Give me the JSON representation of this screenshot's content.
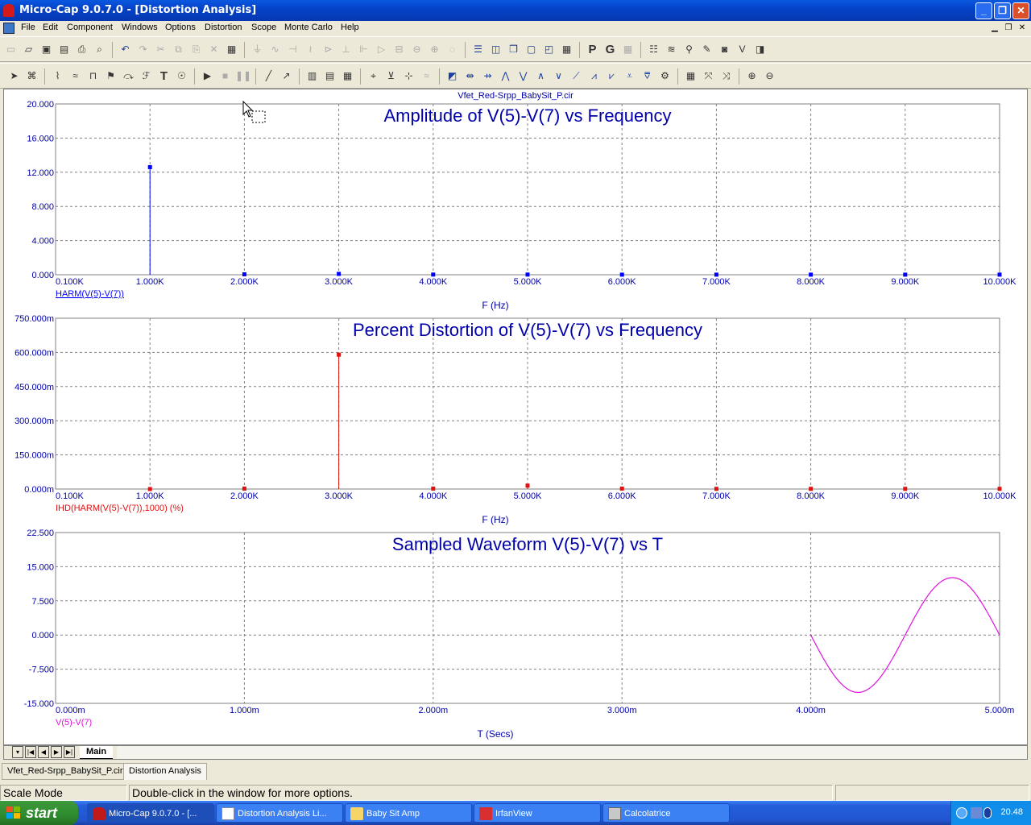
{
  "window": {
    "title": "Micro-Cap 9.0.7.0 - [Distortion Analysis]",
    "min_icon": "minimize-icon",
    "max_icon": "restore-icon",
    "close_icon": "close-icon"
  },
  "menu": {
    "items": [
      "File",
      "Edit",
      "Component",
      "Windows",
      "Options",
      "Distortion",
      "Scope",
      "Monte Carlo",
      "Help"
    ]
  },
  "plot": {
    "filename": "Vfet_Red-Srpp_BabySit_P.cir",
    "cursor_icon": "mouse-pointer-icon"
  },
  "tabs": {
    "main_label": "Main"
  },
  "doc_tabs": [
    "Vfet_Red-Srpp_BabySit_P.cir",
    "Distortion Analysis"
  ],
  "status": {
    "mode": "Scale Mode",
    "hint": "Double-click in the window for more options."
  },
  "taskbar": {
    "start_label": "start",
    "items": [
      {
        "label": "Micro-Cap 9.0.7.0 - [...",
        "icon": "microcap-icon",
        "active": true
      },
      {
        "label": "Distortion Analysis Li...",
        "icon": "notepad-icon",
        "active": false
      },
      {
        "label": "Baby Sit Amp",
        "icon": "folder-icon",
        "active": false
      },
      {
        "label": "IrfanView",
        "icon": "irfanview-icon",
        "active": false
      },
      {
        "label": "Calcolatrice",
        "icon": "calculator-icon",
        "active": false
      }
    ],
    "clock": "20.48"
  },
  "colors": {
    "plot1": "#0000ff",
    "plot2": "#e01010",
    "plot3": "#e010e0",
    "axis_text": "#0000aa",
    "grid": "#808080"
  },
  "chart_data": [
    {
      "type": "bar",
      "title": "Amplitude of V(5)-V(7) vs Frequency",
      "xlabel": "F (Hz)",
      "series_label": "HARM(V(5)-V(7))",
      "x_ticks": [
        "0.100K",
        "1.000K",
        "2.000K",
        "3.000K",
        "4.000K",
        "5.000K",
        "6.000K",
        "7.000K",
        "8.000K",
        "9.000K",
        "10.000K"
      ],
      "y_ticks": [
        "20.000",
        "16.000",
        "12.000",
        "8.000",
        "4.000",
        "0.000"
      ],
      "xlim": [
        0,
        10000
      ],
      "ylim": [
        0,
        20
      ],
      "x": [
        1000,
        2000,
        3000,
        4000,
        5000,
        6000,
        7000,
        8000,
        9000,
        10000
      ],
      "values": [
        12.6,
        0.05,
        0.1,
        0.02,
        0.02,
        0.01,
        0.01,
        0.01,
        0.01,
        0.01
      ],
      "grid": true
    },
    {
      "type": "bar",
      "title": "Percent Distortion of V(5)-V(7) vs Frequency",
      "xlabel": "F (Hz)",
      "series_label": "IHD(HARM(V(5)-V(7)),1000) (%)",
      "x_ticks": [
        "0.100K",
        "1.000K",
        "2.000K",
        "3.000K",
        "4.000K",
        "5.000K",
        "6.000K",
        "7.000K",
        "8.000K",
        "9.000K",
        "10.000K"
      ],
      "y_ticks": [
        "750.000m",
        "600.000m",
        "450.000m",
        "300.000m",
        "150.000m",
        "0.000m"
      ],
      "xlim": [
        0,
        10000
      ],
      "ylim": [
        0,
        0.75
      ],
      "x": [
        1000,
        2000,
        3000,
        4000,
        5000,
        6000,
        7000,
        8000,
        9000,
        10000
      ],
      "values": [
        0,
        0.002,
        0.59,
        0.002,
        0.015,
        0.002,
        0.001,
        0.001,
        0.001,
        0.001
      ],
      "grid": true
    },
    {
      "type": "line",
      "title": "Sampled Waveform  V(5)-V(7) vs T",
      "xlabel": "T (Secs)",
      "series_label": "V(5)-V(7)",
      "x_ticks": [
        "0.000m",
        "1.000m",
        "2.000m",
        "3.000m",
        "4.000m",
        "5.000m"
      ],
      "y_ticks": [
        "22.500",
        "15.000",
        "7.500",
        "0.000",
        "-7.500",
        "-15.000"
      ],
      "xlim": [
        0,
        0.005
      ],
      "ylim": [
        -15,
        22.5
      ],
      "waveform": {
        "t_start": 0.004,
        "t_end": 0.005,
        "amplitude": 12.6,
        "frequency": 1000
      },
      "grid": true
    }
  ]
}
